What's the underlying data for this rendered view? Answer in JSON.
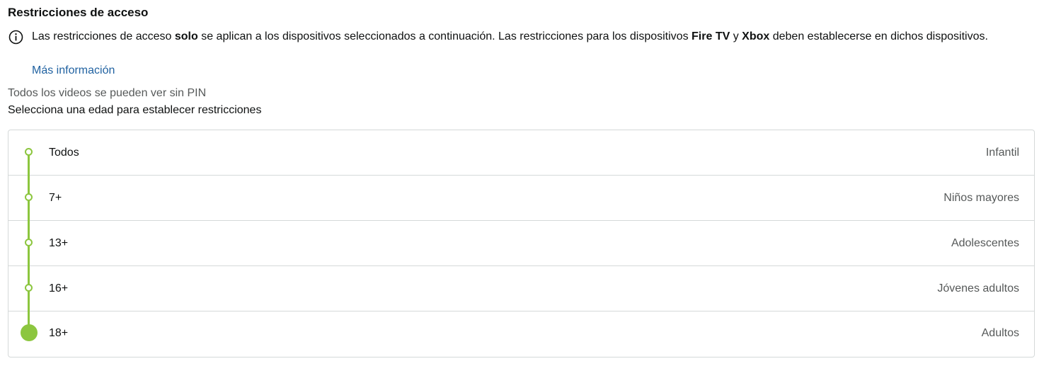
{
  "section": {
    "title": "Restricciones de acceso"
  },
  "info": {
    "icon": "info-icon",
    "text_1": "Las restricciones de acceso ",
    "text_bold_1": "solo",
    "text_2": " se aplican a los dispositivos seleccionados a continuación. Las restricciones para los dispositivos ",
    "text_bold_2": "Fire TV",
    "text_3": " y ",
    "text_bold_3": "Xbox",
    "text_4": " deben establecerse en dichos dispositivos.",
    "link": "Más información"
  },
  "status": {
    "current": "Todos los videos se pueden ver sin PIN",
    "instruction": "Selecciona una edad para establecer restricciones"
  },
  "colors": {
    "accent_green": "#8cc63f",
    "link_blue": "#2162a1",
    "border_gray": "#d5d9d9",
    "muted_text": "#565959"
  },
  "ratings": [
    {
      "age": "Todos",
      "category": "Infantil",
      "selected": false
    },
    {
      "age": "7+",
      "category": "Niños mayores",
      "selected": false
    },
    {
      "age": "13+",
      "category": "Adolescentes",
      "selected": false
    },
    {
      "age": "16+",
      "category": "Jóvenes adultos",
      "selected": false
    },
    {
      "age": "18+",
      "category": "Adultos",
      "selected": true
    }
  ]
}
